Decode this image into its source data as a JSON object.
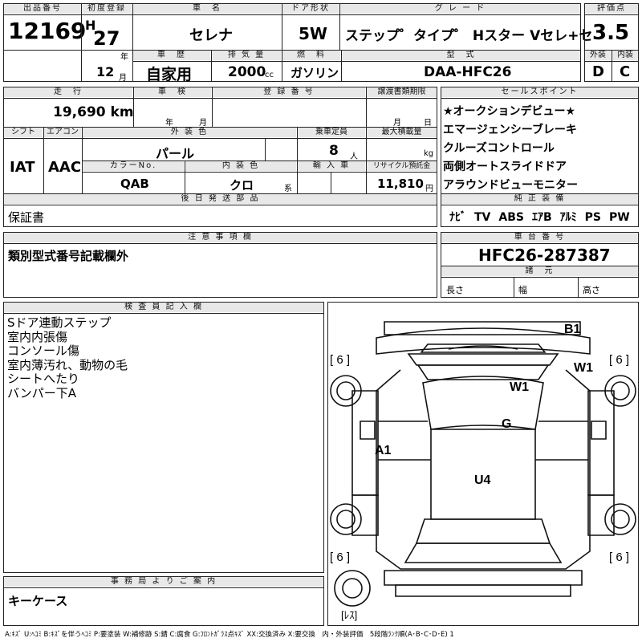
{
  "header": {
    "lot_label": "出品番号",
    "lot_no": "12169",
    "first_reg_label": "初度登録",
    "era": "H",
    "year": "27",
    "year_unit": "年",
    "month": "12",
    "month_unit": "月",
    "car_name_label": "車　名",
    "car_name": "セレナ",
    "door_label": "ドア形状",
    "door": "5W",
    "grade_label": "グ レ ー ド",
    "grade": "ステップ゜タイプ゜ Hスター Vセレ+セ",
    "score_label": "評価点",
    "score": "3.5",
    "history_label": "車　歴",
    "history": "自家用",
    "displacement_label": "排 気 量",
    "displacement": "2000",
    "displacement_unit": "cc",
    "fuel_label": "燃　料",
    "fuel": "ガソリン",
    "model_label": "型　式",
    "model": "DAA-HFC26",
    "exterior_label": "外装",
    "exterior": "D",
    "interior_label": "内装",
    "interior": "C"
  },
  "row2": {
    "mileage_label": "走　行",
    "mileage": "19,690 km",
    "inspection_label": "車　検",
    "insp_year_unit": "年",
    "insp_month_unit": "月",
    "reg_no_label": "登 録 番 号",
    "transfer_label": "譲渡書類期限",
    "tr_month_unit": "月",
    "tr_day_unit": "日",
    "shift_label": "シフト",
    "shift": "IAT",
    "ac_label": "エアコン",
    "ac": "AAC",
    "ext_color_label": "外 装 色",
    "ext_color": "パール",
    "seats_label": "乗車定員",
    "seats": "8",
    "seats_unit": "人",
    "load_label": "最大積載量",
    "load_unit": "kg",
    "color_no_label": "カラーNo.",
    "color_no": "QAB",
    "int_color_label": "内 装 色",
    "int_color": "クロ",
    "int_color_unit": "系",
    "import_label": "輸 入 車",
    "recycle_label": "リサイクル預託金",
    "recycle": "11,810",
    "recycle_unit": "円"
  },
  "sales_points": {
    "label": "セールスポイント",
    "items": [
      "★オークションデビュー★",
      "エマージェンシーブレーキ",
      "クルーズコントロール",
      "両側オートスライドドア",
      "アラウンドビューモニター"
    ]
  },
  "equipment": {
    "label": "純 正 装 備",
    "items": [
      "ﾅﾋﾞ",
      "TV",
      "ABS",
      "ｴｱB",
      "ｱﾙﾐ",
      "PS",
      "PW"
    ]
  },
  "later_parts": {
    "label": "後 日 発 送 部 品",
    "value": "保証書"
  },
  "notes": {
    "label": "注 意 事 項 欄",
    "value": "類別型式番号記載欄外"
  },
  "chassis": {
    "label": "車 台 番 号",
    "value": "HFC26-287387"
  },
  "dimensions": {
    "label": "諸　元",
    "length": "長さ",
    "width": "幅",
    "height": "高さ"
  },
  "inspector": {
    "label": "検 査 員 記 入 欄",
    "lines": [
      "Sドア連動ステップ",
      "室内内張傷",
      "コンソール傷",
      "室内薄汚れ、動物の毛",
      "シートへたり",
      "バンパー下A"
    ]
  },
  "office": {
    "label": "事 務 局 よ り ご 案 内",
    "value": "キーケース"
  },
  "diagram": {
    "marks": [
      "B1",
      "W1",
      "W1",
      "G",
      "A1",
      "U4"
    ],
    "tire_fl": "[ 6 ]",
    "tire_fr": "[ 6 ]",
    "tire_rl": "[ 6 ]",
    "tire_rr": "[ 6 ]",
    "spare": "[ﾚｽ]"
  },
  "legend": "A:ｷｽﾞ U:ﾍｺﾐ B:ｷｽﾞを伴うﾍｺﾐ P:要塗装 W:補修跡 S:錆 C:腐食 G:ﾌﾛﾝﾄｶﾞﾗｽ点ｷｽﾞ XX:交換済み X:要交換　内・外装評価　5段階ﾗﾝｸ順(A･B･C･D･E) 1"
}
